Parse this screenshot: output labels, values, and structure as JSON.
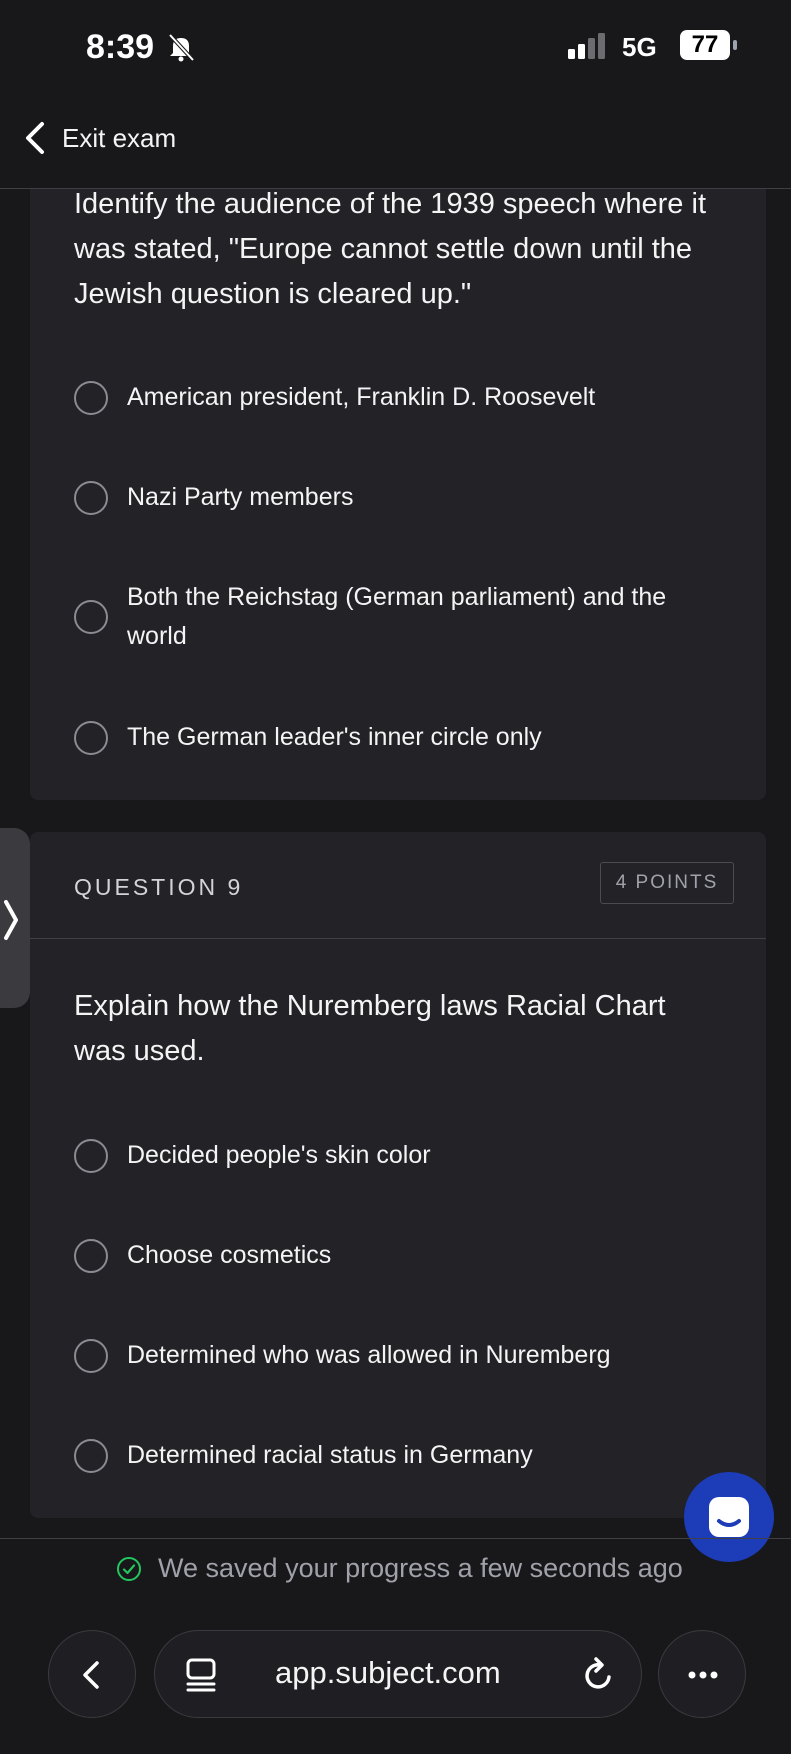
{
  "status_bar": {
    "time": "8:39",
    "network": "5G",
    "battery": "77"
  },
  "header": {
    "back_label": "Exit exam"
  },
  "question8": {
    "text": "Identify the audience of the 1939 speech where it was stated, \"Europe cannot settle down until the Jewish question is cleared up.\"",
    "options": [
      "American president, Franklin D. Roosevelt",
      "Nazi Party members",
      "Both the Reichstag (German parliament) and the world",
      "The German leader's inner circle only"
    ]
  },
  "question9": {
    "label": "QUESTION 9",
    "points": "4 POINTS",
    "text": "Explain how the Nuremberg laws Racial Chart was used.",
    "options": [
      "Decided people's skin color",
      "Choose cosmetics",
      "Determined who was allowed in Nuremberg",
      "Determined racial status in Germany"
    ]
  },
  "footer": {
    "saved_text": "We saved your progress a few seconds ago"
  },
  "browser": {
    "url": "app.subject.com"
  },
  "icons": {
    "back": "chevron-left-icon",
    "bell": "bell-off-icon",
    "check": "check-circle-icon",
    "chat": "chat-icon",
    "tabs": "tabs-icon",
    "reload": "reload-icon",
    "more": "more-icon"
  },
  "colors": {
    "background": "#18181b",
    "card": "#222227",
    "chat_button": "#1d3cb8",
    "success": "#22c55e"
  }
}
